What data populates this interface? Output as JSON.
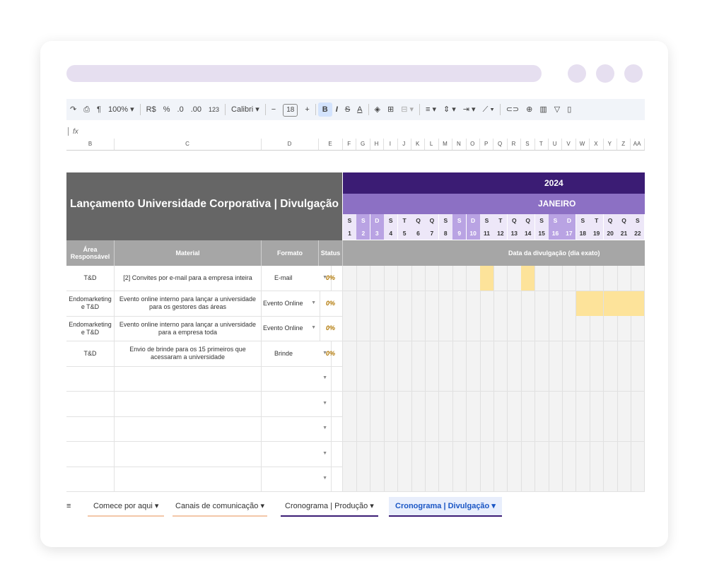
{
  "toolbar": {
    "zoom": "100%",
    "currency": "R$",
    "percent": "%",
    "dec_minus": ".0",
    "dec_plus": ".00",
    "num_format": "123",
    "font": "Calibri",
    "font_size": "18",
    "bold": "B",
    "italic": "I",
    "strike": "S",
    "text_color": "A"
  },
  "formula_bar": {
    "fx": "fx"
  },
  "columns": [
    "B",
    "C",
    "D",
    "E",
    "F",
    "G",
    "H",
    "I",
    "J",
    "K",
    "L",
    "M",
    "N",
    "O",
    "P",
    "Q",
    "R",
    "S",
    "T",
    "U",
    "V",
    "W",
    "X",
    "Y",
    "Z",
    "AA"
  ],
  "sheet": {
    "title": "Lançamento Universidade Corporativa | Divulgação",
    "year": "2024",
    "month": "JANEIRO",
    "weekdays": [
      "S",
      "S",
      "D",
      "S",
      "T",
      "Q",
      "Q",
      "S",
      "S",
      "D",
      "S",
      "T",
      "Q",
      "Q",
      "S",
      "S",
      "D",
      "S",
      "T",
      "Q",
      "Q",
      "S"
    ],
    "days": [
      "1",
      "2",
      "3",
      "4",
      "5",
      "6",
      "7",
      "8",
      "9",
      "10",
      "11",
      "12",
      "13",
      "14",
      "15",
      "16",
      "17",
      "18",
      "19",
      "20",
      "21",
      "22"
    ],
    "headers": {
      "area": "Área Responsável",
      "material": "Material",
      "formato": "Formato",
      "status": "Status",
      "data": "Data da divulgação (dia exato)"
    },
    "rows": [
      {
        "area": "T&D",
        "material": "[2] Convites por e-mail para a empresa inteira",
        "formato": "E-mail",
        "status": "0%",
        "highlight": [
          11,
          14
        ]
      },
      {
        "area": "Endomarketing e T&D",
        "material": "Evento online interno para lançar a universidade para os gestores das áreas",
        "formato": "Evento Online",
        "status": "0%",
        "highlight": [
          18,
          19,
          20,
          21,
          22
        ]
      },
      {
        "area": "Endomarketing e T&D",
        "material": "Evento online interno para lançar a universidade para a empresa toda",
        "formato": "Evento Online",
        "status": "0%",
        "highlight": []
      },
      {
        "area": "T&D",
        "material": "Envio de brinde para os 15 primeiros que acessaram a universidade",
        "formato": "Brinde",
        "status": "0%",
        "highlight": []
      }
    ],
    "empty_rows": 5
  },
  "tabs": {
    "menu": "≡",
    "items": [
      {
        "label": "Comece por aqui"
      },
      {
        "label": "Canais de comunicação"
      },
      {
        "label": "Cronograma | Produção"
      },
      {
        "label": "Cronograma | Divulgação"
      }
    ]
  },
  "colors": {
    "year_bg": "#3b1c74",
    "month_bg": "#8c70c4",
    "weekend_bg": "#b9a3e3",
    "highlight": "#fde39a",
    "title_bg": "#666666",
    "header_bg": "#a6a6a6"
  }
}
